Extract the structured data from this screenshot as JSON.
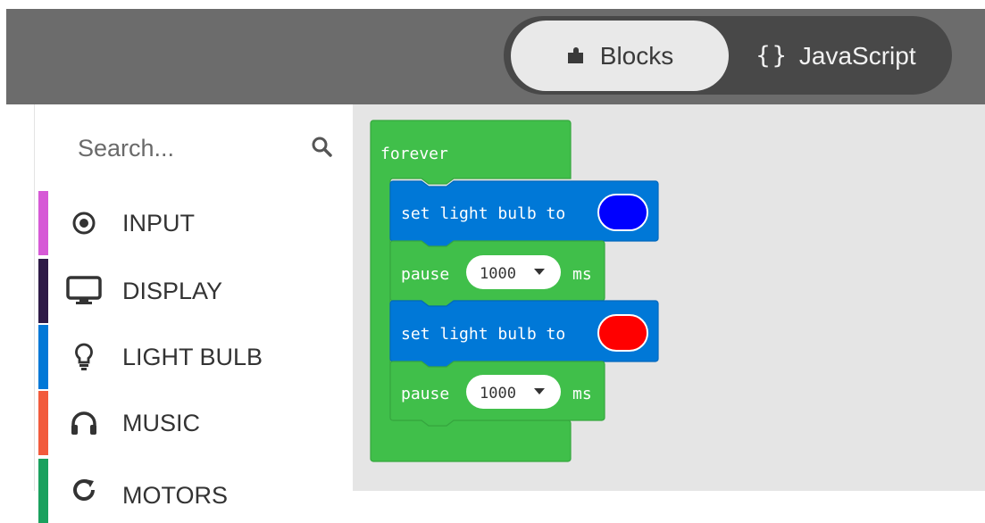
{
  "header": {
    "tabs": [
      {
        "label": "Blocks",
        "icon": "puzzle-icon",
        "active": true
      },
      {
        "label": "JavaScript",
        "icon": "braces-icon",
        "active": false
      }
    ],
    "js_glyph": "{}"
  },
  "toolbox": {
    "search_placeholder": "Search...",
    "categories": [
      {
        "label": "INPUT",
        "color": "#d659d6",
        "icon": "radio-button-icon"
      },
      {
        "label": "DISPLAY",
        "color": "#2e1a47",
        "icon": "monitor-icon"
      },
      {
        "label": "LIGHT BULB",
        "color": "#0078d7",
        "icon": "lightbulb-icon"
      },
      {
        "label": "MUSIC",
        "color": "#f25b3c",
        "icon": "headphones-icon"
      },
      {
        "label": "MOTORS",
        "color": "#1aa15e",
        "icon": "refresh-icon"
      }
    ]
  },
  "workspace": {
    "forever": {
      "label": "forever",
      "color": "#40bf4a"
    },
    "statements": [
      {
        "type": "set_light",
        "label": "set light bulb to",
        "color_value": "#0000ff",
        "block_color": "#0078d7"
      },
      {
        "type": "pause",
        "label": "pause",
        "value": "1000",
        "unit": "ms",
        "block_color": "#40bf4a"
      },
      {
        "type": "set_light",
        "label": "set light bulb to",
        "color_value": "#ff0000",
        "block_color": "#0078d7"
      },
      {
        "type": "pause",
        "label": "pause",
        "value": "1000",
        "unit": "ms",
        "block_color": "#40bf4a"
      }
    ]
  }
}
